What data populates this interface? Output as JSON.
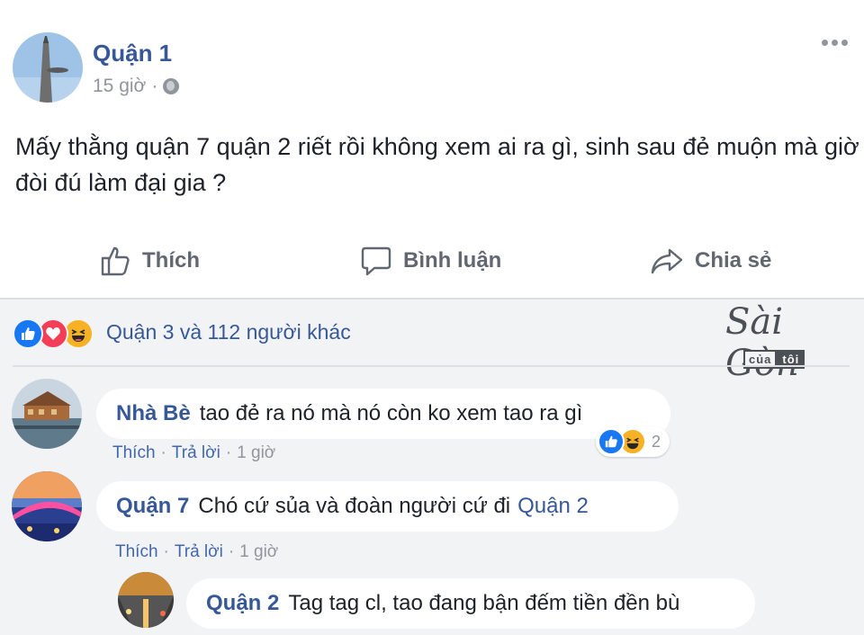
{
  "post": {
    "author": "Quận 1",
    "time": "15 giờ",
    "dot": "·",
    "text": "Mấy thằng quận 7 quận 2 riết rồi không xem ai ra gì, sinh sau đẻ muộn mà giờ đòi đú làm đại gia ?"
  },
  "actions": {
    "like": "Thích",
    "comment": "Bình luận",
    "share": "Chia sẻ"
  },
  "reactions": {
    "summary": "Quận 3 và 112 người khác",
    "icons": [
      "like-icon",
      "love-icon",
      "haha-icon"
    ]
  },
  "logo": {
    "script": "Sài Gòn",
    "part1": "của",
    "part2": "tôi"
  },
  "comments": [
    {
      "name": "Nhà Bè",
      "text": "tao đẻ ra nó mà nó còn ko xem tao ra gì",
      "like": "Thích",
      "reply": "Trả lời",
      "time": "1 giờ",
      "reaction_count": "2"
    },
    {
      "name": "Quận 7",
      "text": "Chó cứ sủa và đoàn người cứ đi",
      "tag": "Quận 2",
      "like": "Thích",
      "reply": "Trả lời",
      "time": "1 giờ"
    },
    {
      "name": "Quận 2",
      "text": "Tag tag cl, tao đang bận đếm tiền đền bù"
    }
  ],
  "colors": {
    "link": "#365899",
    "like_blue": "#1877f2",
    "love_red": "#f33e58",
    "haha_yellow": "#f7b125",
    "comment_bg": "#f2f3f5"
  }
}
